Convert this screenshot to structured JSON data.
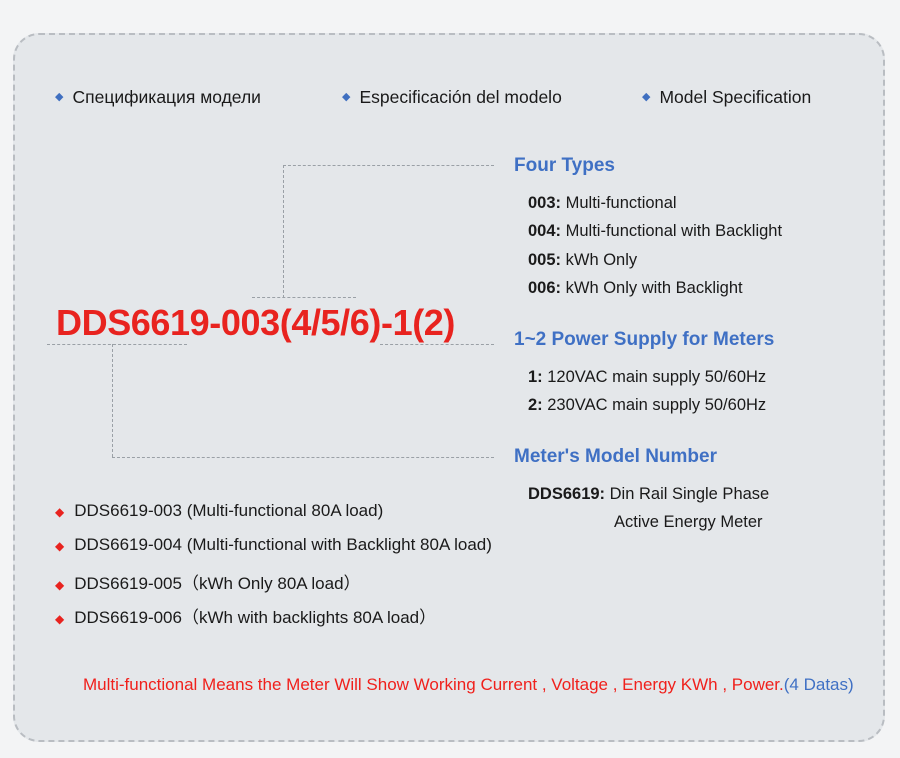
{
  "header": {
    "bullet_icon": "diamond-icon",
    "items": [
      {
        "label": "Спецификация модели"
      },
      {
        "label": "Especificación del modelo"
      },
      {
        "label": "Model Specification"
      }
    ]
  },
  "model_number": "DDS6619-003(4/5/6)-1(2)",
  "blocks": [
    {
      "title": "Four Types",
      "lines": [
        {
          "code": "003:",
          "text": " Multi-functional"
        },
        {
          "code": "004:",
          "text": " Multi-functional with Backlight"
        },
        {
          "code": "005:",
          "text": " kWh Only"
        },
        {
          "code": "006:",
          "text": " kWh Only with Backlight"
        }
      ]
    },
    {
      "title": "1~2 Power Supply for Meters",
      "lines": [
        {
          "code": "1:",
          "text": " 120VAC main supply 50/60Hz"
        },
        {
          "code": "2:",
          "text": " 230VAC main supply 50/60Hz"
        }
      ]
    },
    {
      "title": "Meter's Model Number",
      "lines": [
        {
          "code": "DDS6619:",
          "text": "  Din Rail Single Phase"
        }
      ],
      "continuation": "Active Energy Meter"
    }
  ],
  "bullets": {
    "bullet_icon": "diamond-icon",
    "items": [
      "DDS6619-003 (Multi-functional 80A load)",
      "DDS6619-004 (Multi-functional with Backlight 80A load)",
      "DDS6619-005（kWh Only 80A load）",
      "DDS6619-006（kWh with backlights 80A load）"
    ]
  },
  "note": {
    "red_text": "Multi-functional Means the Meter Will Show Working Current , Voltage , Energy KWh , Power.",
    "blue_text": "(4 Datas)"
  },
  "colors": {
    "accent_blue": "#3f70c4",
    "accent_red": "#e8231f",
    "panel_bg": "#e4e7ea",
    "page_bg": "#f3f4f5",
    "dash_border": "#b9bdc2"
  }
}
